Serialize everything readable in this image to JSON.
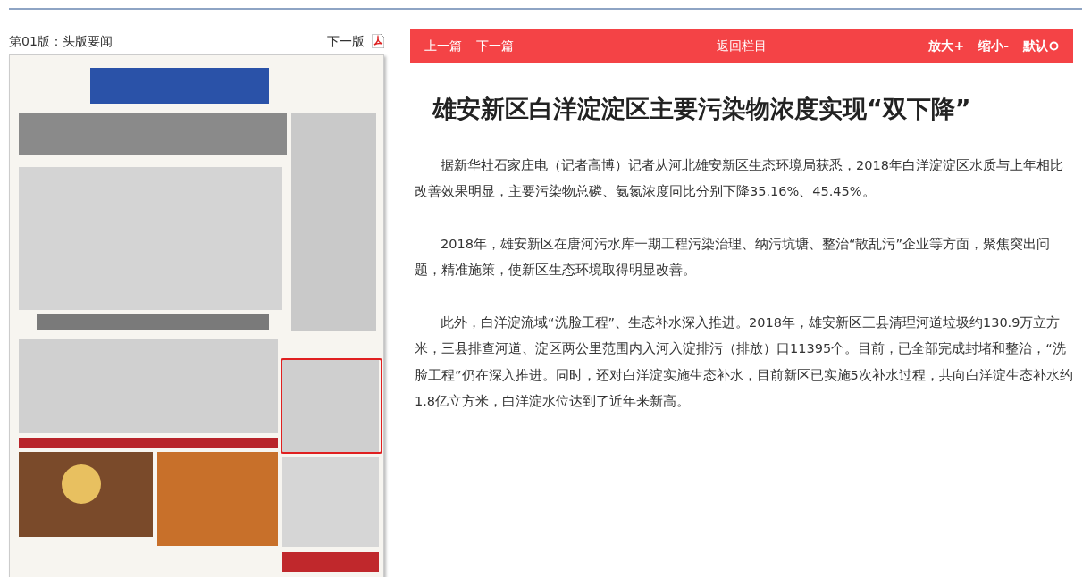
{
  "edition": {
    "label": "第01版：头版要闻",
    "next": "下一版"
  },
  "toolbar": {
    "prev": "上一篇",
    "next": "下一篇",
    "back": "返回栏目",
    "zoom_in": "放大+",
    "zoom_out": "缩小-",
    "reset": "默认"
  },
  "article": {
    "title": "雄安新区白洋淀淀区主要污染物浓度实现“双下降”",
    "paragraphs": [
      "据新华社石家庄电（记者高博）记者从河北雄安新区生态环境局获悉，2018年白洋淀淀区水质与上年相比改善效果明显，主要污染物总磷、氨氮浓度同比分别下降35.16%、45.45%。",
      "2018年，雄安新区在唐河污水库一期工程污染治理、纳污坑塘、整治“散乱污”企业等方面，聚焦突出问题，精准施策，使新区生态环境取得明显改善。",
      "此外，白洋淀流域“洗脸工程”、生态补水深入推进。2018年，雄安新区三县清理河道垃圾约130.9万立方米，三县排查河道、淀区两公里范围内入河入淀排污（排放）口11395个。目前，已全部完成封堵和整治，“洗脸工程”仍在深入推进。同时，还对白洋淀实施生态补水，目前新区已实施5次补水过程，共向白洋淀生态补水约1.8亿立方米，白洋淀水位达到了近年来新高。"
    ]
  }
}
